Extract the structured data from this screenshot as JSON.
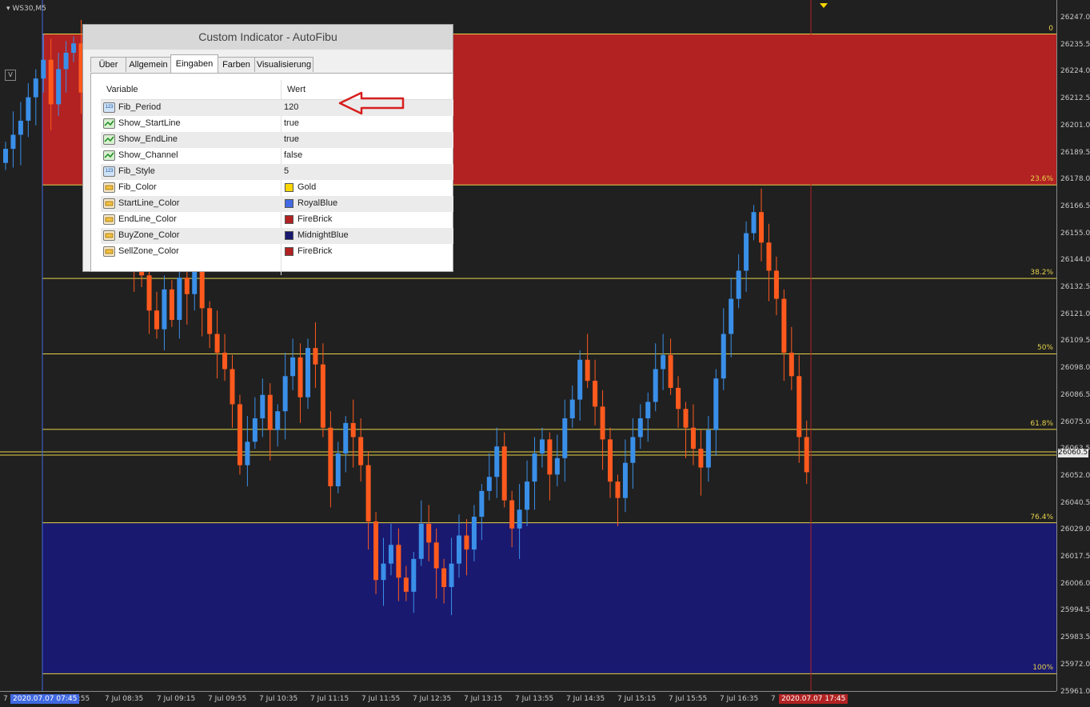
{
  "symbol": "WS30,M5",
  "v_button": "V",
  "colors": {
    "bull": "#3a8fe8",
    "bear": "#ff5a1e",
    "sell_zone": "#b22222",
    "buy_zone": "#191970",
    "fib_line": "#e6d24a",
    "bg": "#202020"
  },
  "price_axis": [
    "26247.0",
    "26235.5",
    "26224.0",
    "26212.5",
    "26201.0",
    "26189.5",
    "26178.0",
    "26166.5",
    "26155.0",
    "26144.0",
    "26132.5",
    "26121.0",
    "26109.5",
    "26098.0",
    "26086.5",
    "26075.0",
    "26063.5",
    "26052.0",
    "26040.5",
    "26029.0",
    "26017.5",
    "26006.0",
    "25994.5",
    "25983.5",
    "25972.0",
    "25961.0"
  ],
  "current_price": "26060.5",
  "time_axis": [
    "7",
    "7:55",
    "7 Jul 08:35",
    "7 Jul 09:15",
    "7 Jul 09:55",
    "7 Jul 10:35",
    "7 Jul 11:15",
    "7 Jul 11:55",
    "7 Jul 12:35",
    "7 Jul 13:15",
    "7 Jul 13:55",
    "7 Jul 14:35",
    "7 Jul 15:15",
    "7 Jul 15:55",
    "7 Jul 16:35",
    "7"
  ],
  "time_start_highlight": "2020.07.07 07:45",
  "time_end_highlight": "2020.07.07 17:45",
  "fib_levels": [
    "0",
    "23.6%",
    "38.2%",
    "50%",
    "61.8%",
    "76.4%",
    "100%"
  ],
  "dialog": {
    "title": "Custom Indicator - AutoFibu",
    "tabs": [
      "Über",
      "Allgemein",
      "Eingaben",
      "Farben",
      "Visualisierung"
    ],
    "active_tab": "Eingaben",
    "col_variable": "Variable",
    "col_value": "Wert",
    "rows": [
      {
        "name": "Fib_Period",
        "value": "120",
        "icon": "int-icon"
      },
      {
        "name": "Show_StartLine",
        "value": "true",
        "icon": "bool-icon"
      },
      {
        "name": "Show_EndLine",
        "value": "true",
        "icon": "bool-icon"
      },
      {
        "name": "Show_Channel",
        "value": "false",
        "icon": "bool-icon"
      },
      {
        "name": "Fib_Style",
        "value": "5",
        "icon": "int-icon"
      },
      {
        "name": "Fib_Color",
        "value": "Gold",
        "icon": "color-icon",
        "swatch": "#ffd700"
      },
      {
        "name": "StartLine_Color",
        "value": "RoyalBlue",
        "icon": "color-icon",
        "swatch": "#4169e1"
      },
      {
        "name": "EndLine_Color",
        "value": "FireBrick",
        "icon": "color-icon",
        "swatch": "#b22222"
      },
      {
        "name": "BuyZone_Color",
        "value": "MidnightBlue",
        "icon": "color-icon",
        "swatch": "#191970"
      },
      {
        "name": "SellZone_Color",
        "value": "FireBrick",
        "icon": "color-icon",
        "swatch": "#b22222"
      }
    ]
  },
  "chart_data": {
    "type": "candlestick",
    "close_series": [
      26191,
      26197,
      26203,
      26213,
      26221,
      26229,
      26210,
      26225,
      26232,
      26236,
      26215,
      26194,
      26205,
      26198,
      26186,
      26168,
      26154,
      26141,
      26137,
      26122,
      26114,
      26131,
      26118,
      26136,
      26129,
      26140,
      26123,
      26112,
      26104,
      26097,
      26082,
      26056,
      26066,
      26076,
      26086,
      26071,
      26079,
      26094,
      26102,
      26085,
      26106,
      26099,
      26072,
      26047,
      26061,
      26074,
      26068,
      26056,
      26032,
      26007,
      26014,
      26022,
      26008,
      26002,
      26016,
      26031,
      26023,
      26012,
      26004,
      26014,
      26026,
      26020,
      26034,
      26045,
      26051,
      26064,
      26041,
      26029,
      26037,
      26049,
      26061,
      26067,
      26052,
      26059,
      26076,
      26084,
      26101,
      26092,
      26081,
      26067,
      26049,
      26042,
      26057,
      26068,
      26076,
      26083,
      26097,
      26103,
      26089,
      26080,
      26072,
      26063,
      26055,
      26071,
      26093,
      26112,
      26127,
      26139,
      26155,
      26164,
      26151,
      26139,
      26127,
      26104,
      26094,
      26068,
      26053
    ],
    "fib_levels_pct": [
      0,
      23.6,
      38.2,
      50,
      61.8,
      76.4,
      100
    ]
  }
}
